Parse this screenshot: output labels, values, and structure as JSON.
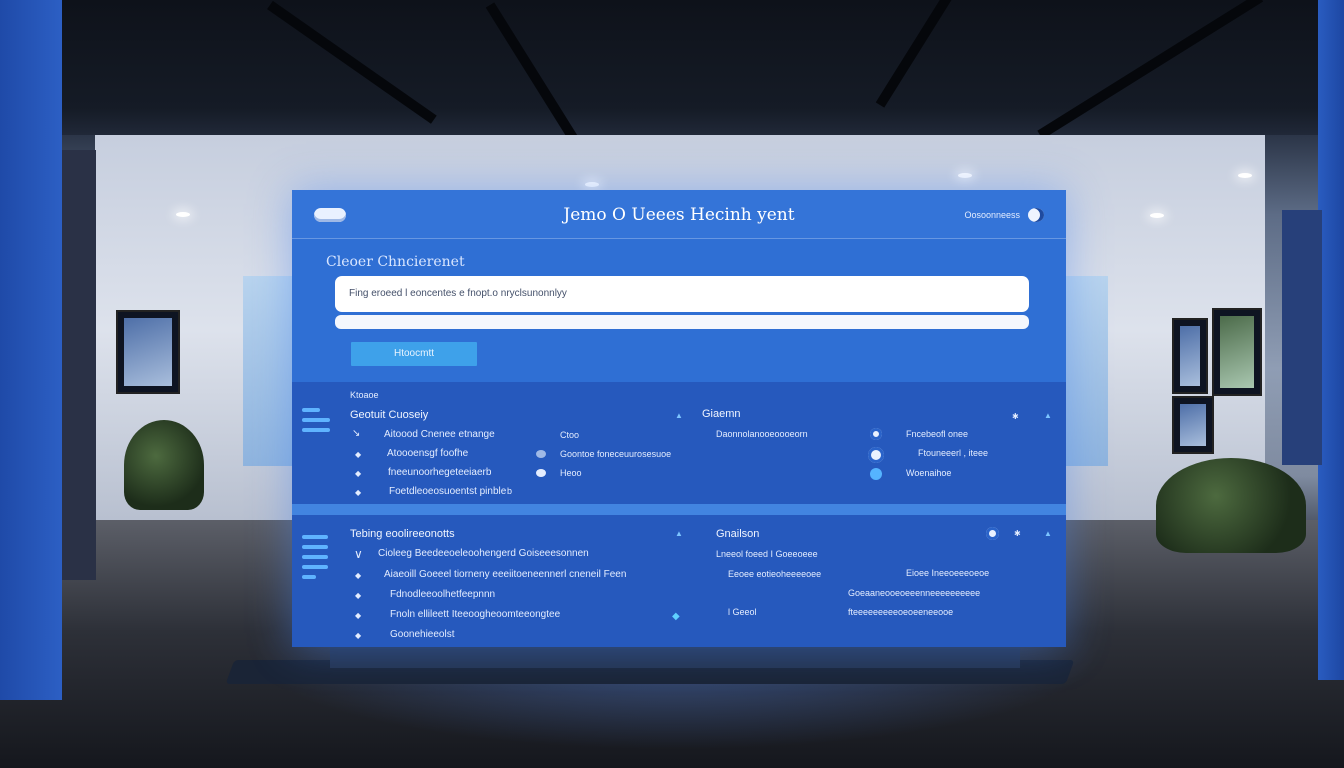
{
  "header": {
    "title": "Jemo O Ueees Hecinh yent",
    "right_text": "Oosoonneess"
  },
  "form": {
    "section_label": "Cleoer Chncierenet",
    "input_text": "Fing eroeed l eoncentes e fnopt.o nryclsunonnlyy",
    "submit_label": "Htoocmtt"
  },
  "card_top": {
    "label": "Ktoaoe",
    "left": {
      "title": "Geotuit Cuoseiy",
      "rows": [
        {
          "text": "Aitoood Cnenee etnange",
          "value": "Ctoo"
        },
        {
          "text": "Atoooensgf foofhe",
          "value": "Goontoe foneceuurosesuoe"
        },
        {
          "text": "fneeunoorhegeteeiaerb",
          "value": "Heoo"
        },
        {
          "text": "Foetdleoeosuoentst pinble",
          "value": "b"
        }
      ]
    },
    "right": {
      "title": "Giaemn",
      "rows": [
        {
          "text": "Daonnolanooeoooeorn",
          "value": "Fncebeofl onee"
        },
        {
          "text": "",
          "value": "Ftouneeerl , iteee"
        },
        {
          "text": "",
          "value": "Woenaihoe"
        }
      ]
    }
  },
  "card_bottom": {
    "left": {
      "title": "Tebing eoolireeonotts",
      "rows": [
        {
          "text": "Cioleeg Beedeeoeleoohengerd Goiseeesonnen"
        },
        {
          "text": "Aiaeoill Goeeel tiorneny eeeiitoeneennerl cneneil Feen"
        },
        {
          "text": "Fdnodleeoolhetfeepnnn"
        },
        {
          "text": "Fnoln ellileett Iteeoogheoomteeongtee"
        },
        {
          "text": "Goonehieeolst"
        }
      ]
    },
    "right": {
      "title": "Gnailson",
      "rows": [
        {
          "text": "Lneeol foeed I Goeeoeee",
          "value": ""
        },
        {
          "text": "Eeoee eotieoheeeeoee",
          "value": "Eioee Ineeoeeeoeoe"
        },
        {
          "text": "",
          "value": "Goeaaneooeoeeenneeeeeeeeee"
        },
        {
          "text": "l Geeol",
          "value": "fteeeeeeeeeoeoeeneeooe"
        }
      ]
    }
  }
}
